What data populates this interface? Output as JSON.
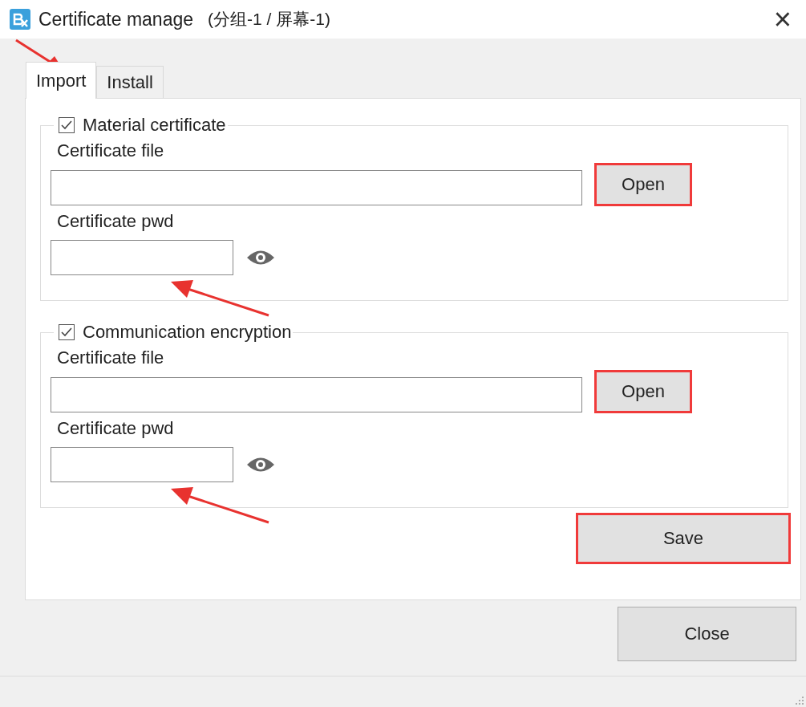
{
  "window": {
    "title": "Certificate manage",
    "subtitle": "(分组-1 / 屏幕-1)",
    "close": "×"
  },
  "tabs": [
    {
      "label": "Import",
      "selected": true,
      "highlighted": true
    },
    {
      "label": "Install",
      "selected": false,
      "highlighted": false
    }
  ],
  "groups": [
    {
      "title": "Material certificate",
      "checked": true,
      "file_label": "Certificate file",
      "open_button": {
        "label": "Open",
        "highlighted": true
      },
      "pwd_label": "Certificate pwd",
      "pwd_highlighted": true
    },
    {
      "title": "Communication encryption",
      "checked": true,
      "file_label": "Certificate file",
      "open_button": {
        "label": "Open",
        "highlighted": true
      },
      "pwd_label": "Certificate pwd",
      "pwd_highlighted": true
    }
  ],
  "save_button": {
    "label": "Save",
    "highlighted": true
  },
  "close_button": {
    "label": "Close"
  }
}
